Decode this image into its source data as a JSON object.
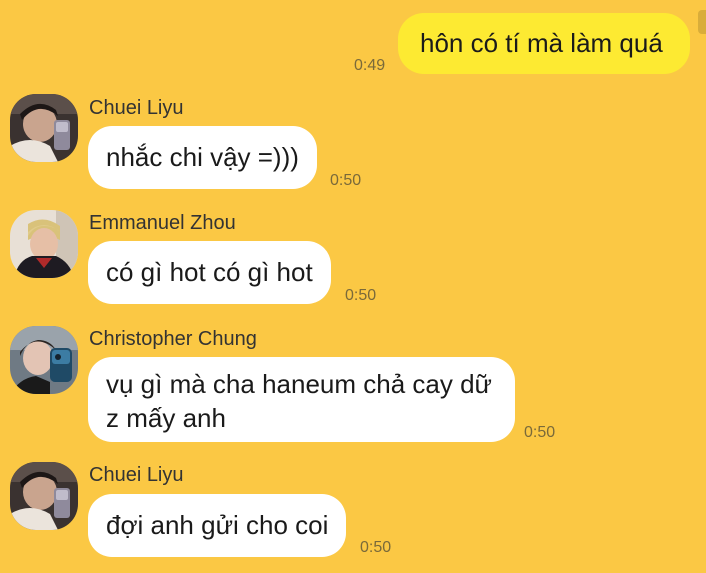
{
  "messages": [
    {
      "id": "m0",
      "direction": "out",
      "text": "hôn có tí mà làm quá",
      "time": "0:49"
    },
    {
      "id": "m1",
      "direction": "in",
      "sender": "Chuei Liyu",
      "text": "nhắc chi vậy =)))",
      "time": "0:50"
    },
    {
      "id": "m2",
      "direction": "in",
      "sender": "Emmanuel Zhou",
      "text": "có gì hot có gì hot",
      "time": "0:50"
    },
    {
      "id": "m3",
      "direction": "in",
      "sender": "Christopher Chung",
      "lines": [
        "vụ gì mà cha haneum chả cay dữ",
        "z mấy anh"
      ],
      "time": "0:50"
    },
    {
      "id": "m4",
      "direction": "in",
      "sender": "Chuei Liyu",
      "text": "đợi anh gửi cho coi",
      "time": "0:50"
    }
  ],
  "colors": {
    "background": "#fbc844",
    "outgoing_bubble": "#fdea32",
    "incoming_bubble": "#ffffff",
    "timestamp": "#7a6a3a"
  }
}
